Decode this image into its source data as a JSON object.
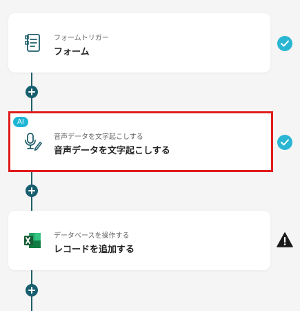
{
  "steps": [
    {
      "subtitle": "フォームトリガー",
      "title": "フォーム",
      "icon": "form-icon",
      "status": "complete"
    },
    {
      "badge": "AI",
      "subtitle": "音声データを文字起こしする",
      "title": "音声データを文字起こしする",
      "icon": "microphone-pen-icon",
      "status": "complete",
      "highlighted": true
    },
    {
      "subtitle": "データベースを操作する",
      "title": "レコードを追加する",
      "icon": "excel-icon",
      "status": "warning"
    }
  ],
  "colors": {
    "connector": "#1f5f6a",
    "plus_button": "#175e6e",
    "check": "#2ab6d2",
    "ai_badge": "#1fb6d6",
    "highlight_border": "#e01c1c",
    "warning": "#1a1a1a"
  }
}
